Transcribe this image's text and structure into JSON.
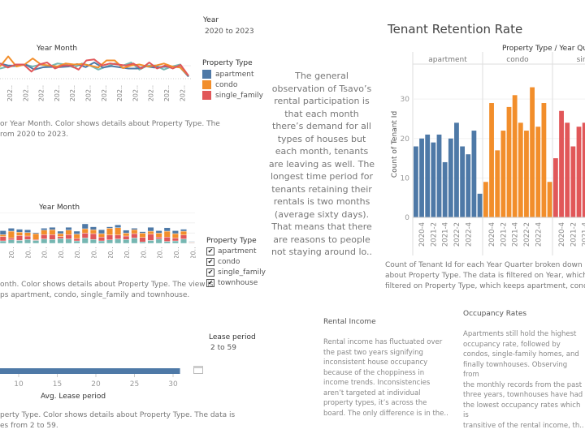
{
  "colors": {
    "apartment": "#4e79a7",
    "condo": "#f28e2b",
    "single_family": "#e15759",
    "townhouse": "#76b7b2"
  },
  "line_chart": {
    "axis_title": "Year Month",
    "caption_line1": "or Year Month.  Color shows details about Property Type. The",
    "caption_line2": "rom 2020 to 2023."
  },
  "year_filter": {
    "title": "Year",
    "value": "2020 to 2023"
  },
  "legend_line": {
    "title": "Property Type",
    "items": [
      {
        "label": "apartment",
        "key": "apartment"
      },
      {
        "label": "condo",
        "key": "condo"
      },
      {
        "label": "single_family",
        "key": "single_family"
      }
    ]
  },
  "stacked_chart": {
    "axis_title": "Year Month",
    "caption_line1": "onth.  Color shows details about Property Type. The view is",
    "caption_line2": "ps apartment, condo, single_family and townhouse."
  },
  "legend_stacked": {
    "title": "Property Type",
    "items": [
      {
        "label": "apartment",
        "checked": true
      },
      {
        "label": "condo",
        "checked": true
      },
      {
        "label": "single_family",
        "checked": true
      },
      {
        "label": "townhouse",
        "checked": true
      }
    ]
  },
  "lease_chart": {
    "axis_title": "Avg. Lease period",
    "caption_line1": "perty Type.  Color shows details about Property Type. The data is",
    "caption_line2": "es from 2 to 59."
  },
  "lease_filter": {
    "title": "Lease period",
    "value": "2 to 59"
  },
  "story_text": {
    "lines": [
      "The general",
      "observation of Tsavo’s",
      "rental participation is",
      "that each month",
      "there’s demand for all",
      "types of houses but",
      "each month, tenants",
      "are leaving as well. The",
      "longest time period for",
      "tenants retaining their",
      "rentals is two months",
      "(average sixty days).",
      "That means that there",
      "are reasons to people",
      "not staying around lo.."
    ]
  },
  "retention": {
    "title": "Tenant Retention Rate",
    "header": "Property Type  /  Year Qua",
    "caption_line1": "Count of Tenant Id for each Year Quarter broken down by Proper",
    "caption_line2": "about Property Type. The data is filtered on Year, which ranges f",
    "caption_line3": "filtered on Property Type, which keeps apartment, condo, single_"
  },
  "rental_income": {
    "title": "Rental Income",
    "lines": [
      "Rental income has fluctuated over",
      "the past two years signifying",
      "inconsistent house occupancy",
      "because of the choppiness in",
      "income trends. Inconsistencies",
      "aren’t targeted at individual",
      "property types, it’s across the",
      "board. The only difference is in the.."
    ]
  },
  "occupancy": {
    "title": "Occupancy Rates",
    "lines": [
      "Apartments still hold the highest",
      "occupancy rate, followed by",
      "condos, single-family homes, and",
      "finally townhouses. Observing from",
      "the monthly records from the past",
      "three years, townhouses have had",
      "the lowest occupancy rates which is",
      "transitive of the rental income, th.."
    ]
  },
  "chart_data": [
    {
      "type": "line",
      "title": "",
      "xlabel": "Year Month",
      "ylabel": "",
      "x_tick_label": "202..",
      "x_tick_count": 12,
      "series": [
        {
          "name": "apartment",
          "values": [
            7.5,
            6.5,
            6.4,
            7,
            4.5,
            5.6,
            5.8,
            5.7,
            6,
            7.2,
            5.7,
            8,
            5.5,
            6.2,
            5.6,
            5,
            5,
            6.1,
            5.5,
            5.8,
            6,
            5.7,
            1
          ]
        },
        {
          "name": "condo",
          "values": [
            6,
            11,
            6,
            7,
            10,
            7,
            6.5,
            6,
            7.5,
            7,
            7.2,
            6.5,
            5.5,
            9,
            9,
            5.2,
            6.5,
            7,
            6,
            6.5,
            7.5,
            6,
            5.5,
            1.5
          ]
        },
        {
          "name": "single_family",
          "values": [
            7.5,
            5.5,
            7,
            7,
            3.5,
            7,
            8,
            5,
            6.5,
            6.5,
            4.5,
            9,
            9.5,
            6.5,
            7.5,
            7,
            6.5,
            7.5,
            5,
            8,
            5,
            6.5,
            5,
            6.8,
            1.5
          ]
        },
        {
          "name": "townhouse",
          "values": [
            5,
            6,
            6.2,
            7,
            6,
            7,
            6,
            7.5,
            7,
            5.5,
            7.5,
            6.5,
            4.5,
            6,
            7.5,
            6.5,
            8,
            4.5,
            6.5,
            6.5,
            4.5,
            6,
            7,
            1
          ]
        }
      ]
    },
    {
      "type": "bar",
      "stacked": true,
      "title": "",
      "xlabel": "Year Month",
      "x_tick_label": "20..",
      "x_tick_count": 12,
      "series": [
        {
          "name": "townhouse",
          "values": [
            5,
            7,
            6,
            8,
            6,
            9,
            8,
            10,
            9,
            5,
            11,
            8,
            5,
            7,
            9,
            8,
            11,
            3,
            6,
            9,
            4,
            5,
            9,
            1
          ]
        },
        {
          "name": "single_family",
          "values": [
            9,
            4,
            10,
            7,
            2,
            9,
            10,
            4,
            9,
            5,
            10,
            12,
            8,
            10,
            8,
            7,
            9,
            9,
            13,
            4,
            9,
            6,
            8,
            1
          ]
        },
        {
          "name": "condo",
          "values": [
            4,
            14,
            7,
            7,
            12,
            9,
            10,
            6,
            9,
            9,
            9,
            8,
            7,
            14,
            15,
            6,
            8,
            9,
            6,
            8,
            12,
            9,
            8,
            1
          ]
        },
        {
          "name": "apartment",
          "values": [
            8,
            6,
            6,
            6,
            2,
            4,
            5,
            5,
            6,
            6,
            10,
            6,
            8,
            3,
            6,
            6,
            3,
            3,
            8,
            5,
            7,
            6,
            4,
            1
          ]
        }
      ]
    },
    {
      "type": "bar",
      "orientation": "horizontal",
      "xlabel": "Avg. Lease period",
      "x_ticks": [
        10,
        15,
        20,
        25,
        30
      ],
      "series": [
        {
          "name": "townhouse",
          "values": [
            30.9
          ]
        }
      ]
    },
    {
      "type": "bar",
      "title": "Tenant Retention Rate",
      "ylabel": "Count of Tenant Id",
      "y_ticks": [
        0,
        10,
        20,
        30
      ],
      "ylim": [
        0,
        36
      ],
      "header": "Property Type / Year Quarter",
      "x_tick_labels": [
        "2020-4",
        "2021-2",
        "2021-4",
        "2022-2",
        "2022-4"
      ],
      "panels": [
        {
          "name": "apartment",
          "categories": [
            "2020-3",
            "2020-4",
            "2021-1",
            "2021-2",
            "2021-3",
            "2021-4",
            "2022-1",
            "2022-2",
            "2022-3",
            "2022-4",
            "2023-1",
            "2023-2"
          ],
          "values": [
            18,
            20,
            21,
            19,
            21,
            14,
            20,
            24,
            18,
            16,
            22,
            6
          ]
        },
        {
          "name": "condo",
          "categories": [
            "2020-3",
            "2020-4",
            "2021-1",
            "2021-2",
            "2021-3",
            "2021-4",
            "2022-1",
            "2022-2",
            "2022-3",
            "2022-4",
            "2023-1",
            "2023-2"
          ],
          "values": [
            9,
            29,
            17,
            22,
            28,
            31,
            24,
            22,
            33,
            23,
            29,
            9
          ]
        },
        {
          "name": "single",
          "categories": [
            "2020-3",
            "2020-4",
            "2021-1",
            "2021-2",
            "2021-3",
            "2021-4"
          ],
          "values": [
            15,
            27,
            24,
            18,
            23,
            24
          ]
        }
      ]
    }
  ]
}
